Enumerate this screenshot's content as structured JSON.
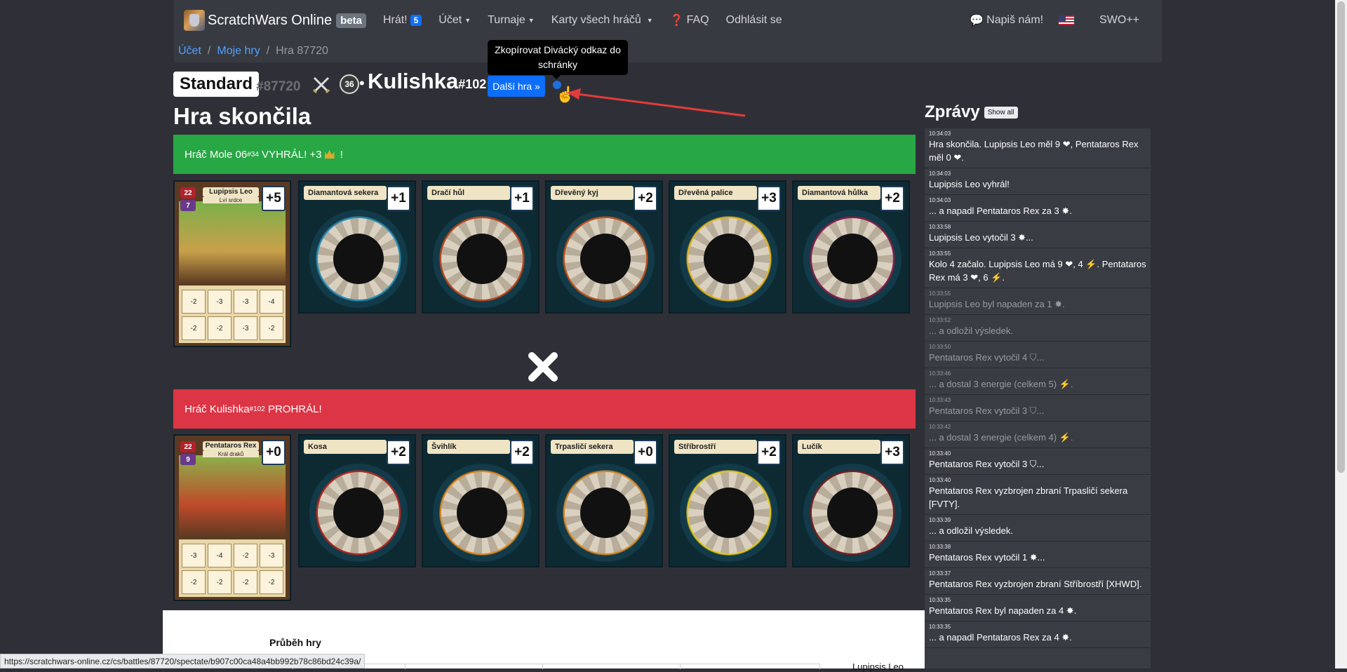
{
  "nav": {
    "brand": "ScratchWars Online",
    "beta": "beta",
    "play": "Hrát!",
    "play_badge": "5",
    "account": "Účet",
    "tournaments": "Turnaje",
    "cards": "Karty všech hráčů",
    "faq": "FAQ",
    "logout": "Odhlásit se",
    "write_us": "Napiš nám!",
    "swo_plus": "SWO++"
  },
  "breadcrumb": {
    "item1": "Účet",
    "item2": "Moje hry",
    "current": "Hra 87720"
  },
  "game": {
    "mode": "Standard",
    "number": "#87720",
    "opponent_level": "36",
    "opponent_name": "Kulishka",
    "opponent_tag": "#102",
    "next_button": "Další hra »",
    "tooltip": "Zkopírovat Divácký odkaz do schránky",
    "status": "Hra skončila"
  },
  "winner": {
    "prefix": "Hráč Mole 06",
    "tag": "#34",
    "suffix": " VYHRÁL! +3",
    "end": " !"
  },
  "loser": {
    "prefix": "Hráč Kulishka",
    "tag": "#102",
    "suffix": " PROHRÁL!"
  },
  "winner_cards": {
    "hero": {
      "name": "Lupipsis Leo",
      "subtitle": "Lví srdce",
      "hp": "22",
      "energy": "7",
      "bonus": "+5",
      "cells": [
        "-2",
        "-3",
        "-3",
        "-4",
        "-2",
        "-2",
        "-3",
        "-2"
      ]
    },
    "weapons": [
      {
        "name": "Diamantová sekera",
        "bonus": "+1",
        "accent": "#2d8fb4"
      },
      {
        "name": "Dračí hůl",
        "bonus": "+1",
        "accent": "#c04a1e"
      },
      {
        "name": "Dřevěný kyj",
        "bonus": "+2",
        "accent": "#c0571e"
      },
      {
        "name": "Dřevěná palice",
        "bonus": "+3",
        "accent": "#e6b41e"
      },
      {
        "name": "Diamantová hůlka",
        "bonus": "+2",
        "accent": "#8a1e4a"
      }
    ]
  },
  "loser_cards": {
    "hero": {
      "name": "Pentataros Rex",
      "subtitle": "Král draků",
      "hp": "22",
      "energy": "9",
      "bonus": "+0",
      "cells": [
        "-3",
        "-4",
        "-2",
        "-3",
        "-2",
        "-2",
        "-2",
        "-2"
      ]
    },
    "weapons": [
      {
        "name": "Kosa",
        "bonus": "+2",
        "accent": "#b4281e"
      },
      {
        "name": "Švihlík",
        "bonus": "+2",
        "accent": "#e08a1e"
      },
      {
        "name": "Trpasličí sekera",
        "bonus": "+0",
        "accent": "#d88a28"
      },
      {
        "name": "Stříbrostří",
        "bonus": "+2",
        "accent": "#e6c81e"
      },
      {
        "name": "Lučík",
        "bonus": "+3",
        "accent": "#7a1e1e"
      }
    ]
  },
  "messages": {
    "title": "Zprávy",
    "show_all": "Show all",
    "items": [
      {
        "time": "10:34:03",
        "text": "Hra skončila. Lupipsis Leo měl 9 ❤, Pentataros Rex měl 0 ❤.",
        "dim": false
      },
      {
        "time": "10:34:03",
        "text": "Lupipsis Leo vyhrál!",
        "dim": false
      },
      {
        "time": "10:34:03",
        "text": "... a napadl Pentataros Rex za 3 ✸.",
        "dim": false
      },
      {
        "time": "10:33:58",
        "text": "Lupipsis Leo vytočil 3 ✸...",
        "dim": false
      },
      {
        "time": "10:33:55",
        "text": "Kolo 4 začalo. Lupipsis Leo má 9 ❤, 4 ⚡. Pentataros Rex má 3 ❤, 6 ⚡.",
        "dim": false
      },
      {
        "time": "10:33:55",
        "text": "Lupipsis Leo byl napaden za 1 ✸.",
        "dim": true
      },
      {
        "time": "10:33:52",
        "text": "... a odložil výsledek.",
        "dim": true
      },
      {
        "time": "10:33:50",
        "text": "Pentataros Rex vytočil 4 ⛉...",
        "dim": true
      },
      {
        "time": "10:33:46",
        "text": "... a dostal 3 energie (celkem 5) ⚡.",
        "dim": true
      },
      {
        "time": "10:33:43",
        "text": "Pentataros Rex vytočil 3 ⛉...",
        "dim": true
      },
      {
        "time": "10:33:42",
        "text": "... a dostal 3 energie (celkem 4) ⚡.",
        "dim": true
      },
      {
        "time": "10:33:40",
        "text": "Pentataros Rex vytočil 3 ⛉...",
        "dim": false
      },
      {
        "time": "10:33:40",
        "text": "Pentataros Rex vyzbrojen zbraní Trpasličí sekera [FVTY].",
        "dim": false
      },
      {
        "time": "10:33:39",
        "text": "... a odložil výsledek.",
        "dim": false
      },
      {
        "time": "10:33:38",
        "text": "Pentataros Rex vytočil 1 ✸...",
        "dim": false
      },
      {
        "time": "10:33:37",
        "text": "Pentataros Rex vyzbrojen zbraní Stříbrostří [XHWD].",
        "dim": false
      },
      {
        "time": "10:33:35",
        "text": "Pentataros Rex byl napaden za 4 ✸.",
        "dim": false
      },
      {
        "time": "10:33:35",
        "text": "... a napadl Pentataros Rex za 4 ✸.",
        "dim": false
      }
    ]
  },
  "bottom": {
    "progress_title": "Průběh hry",
    "right_name": "Lupipsis Leo"
  },
  "status_url": "https://scratchwars-online.cz/cs/battles/87720/spectate/b907c00ca48a4bb992b78c86bd24c39a/"
}
